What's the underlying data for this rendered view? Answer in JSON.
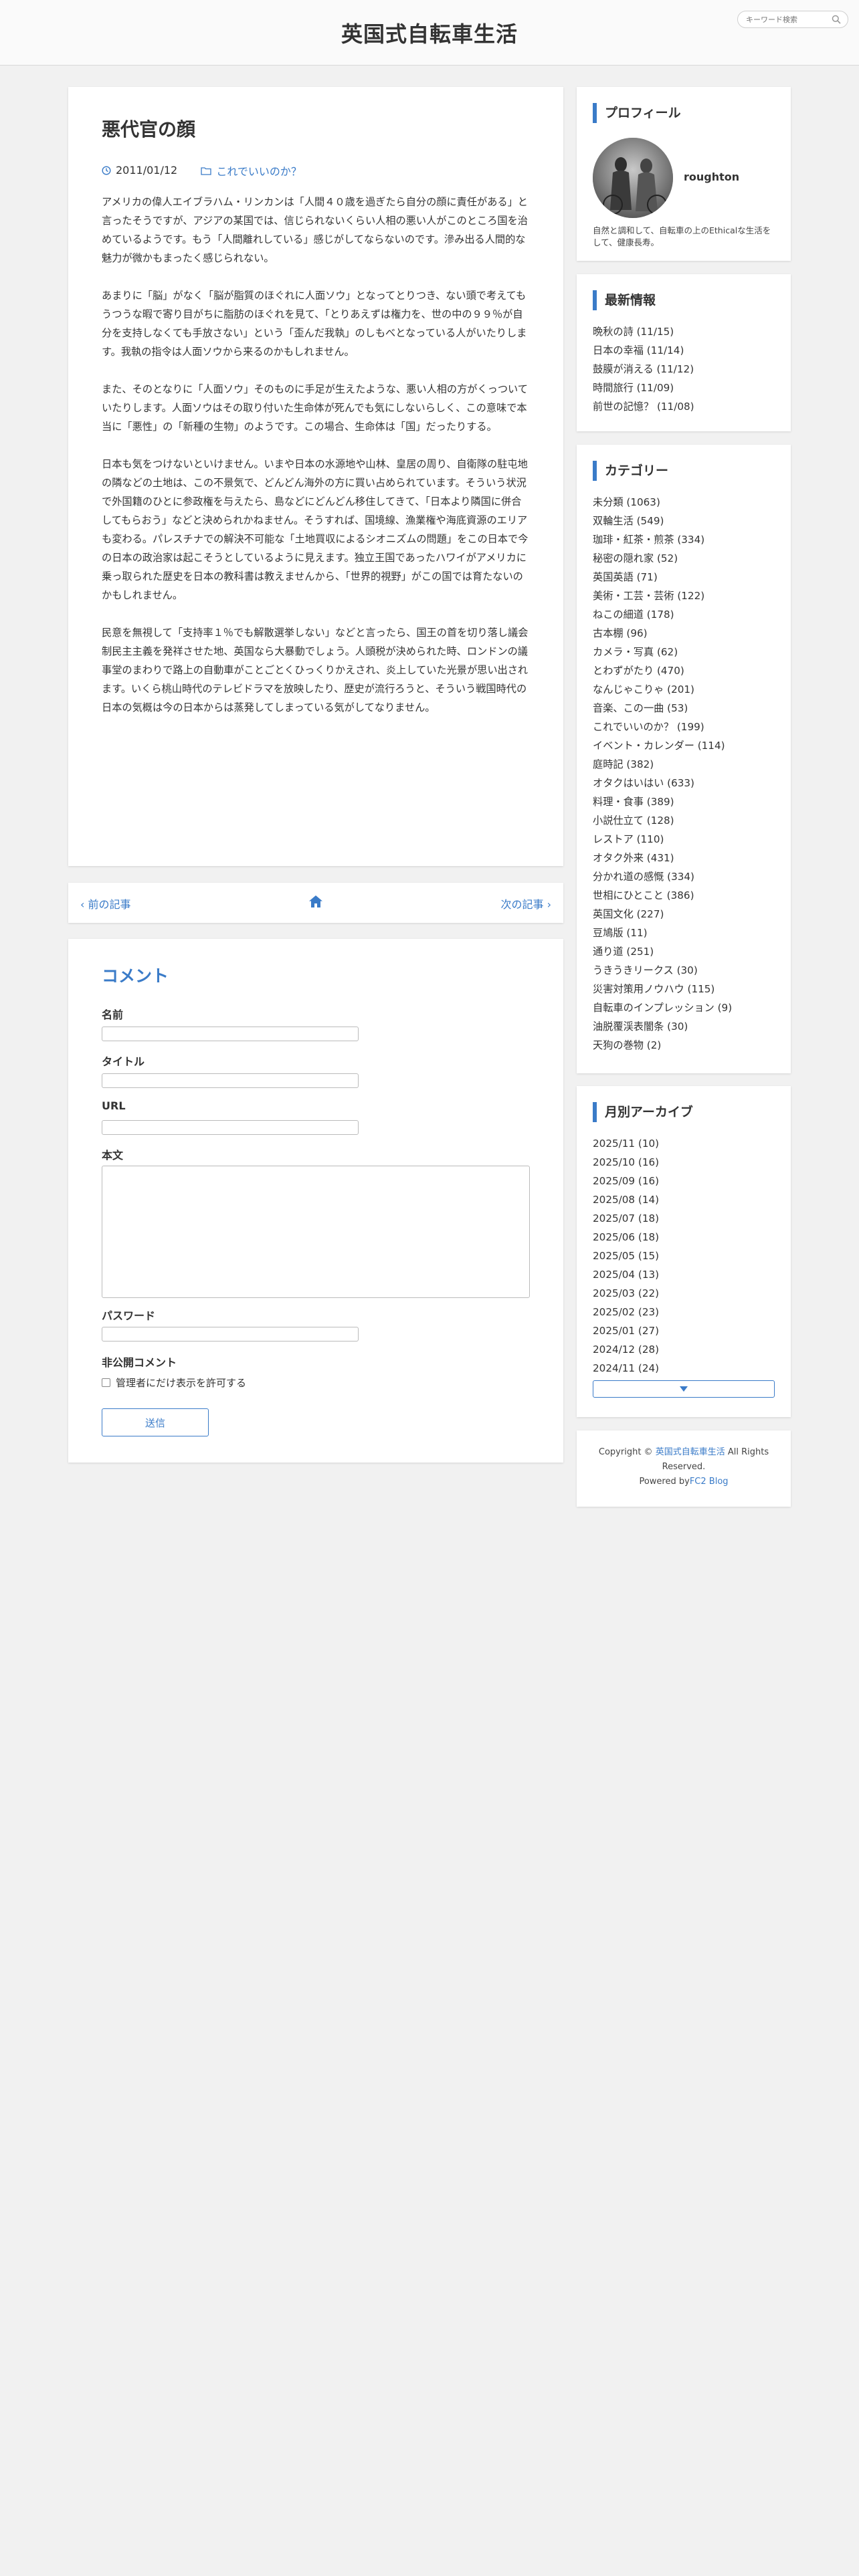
{
  "header": {
    "site_title": "英国式自転車生活",
    "search_placeholder": "キーワード検索"
  },
  "article": {
    "title": "悪代官の顔",
    "date": "2011/01/12",
    "category": "これでいいのか？",
    "paragraphs": [
      "アメリカの偉人エイブラハム・リンカンは「人間４０歳を過ぎたら自分の顔に責任がある」と言ったそうですが、アジアの某国では、信じられないくらい人相の悪い人がこのところ国を治めているようです。もう「人間離れしている」感じがしてならないのです。滲み出る人間的な魅力が微かもまったく感じられない。",
      "あまりに「脳」がなく「脳が脂質のほぐれに人面ソウ」となってとりつき、ない頭で考えてもうつうな暇で寄り目がちに脂肪のほぐれを見て、「とりあえずは権力を、世の中の９９％が自分を支持しなくても手放さない」という「歪んだ我執」のしもべとなっている人がいたりします。我執の指令は人面ソウから来るのかもしれません。",
      "また、そのとなりに「人面ソウ」そのものに手足が生えたような、悪い人相の方がくっついていたりします。人面ソウはその取り付いた生命体が死んでも気にしないらしく、この意味で本当に「悪性」の「新種の生物」のようです。この場合、生命体は「国」だったりする。",
      "日本も気をつけないといけません。いまや日本の水源地や山林、皇居の周り、自衛隊の駐屯地の隣などの土地は、この不景気で、どんどん海外の方に買い占められています。そういう状況で外国籍のひとに参政権を与えたら、島などにどんどん移住してきて、「日本より隣国に併合してもらおう」などと決められかねません。そうすれば、国境線、漁業権や海底資源のエリアも変わる。パレスチナでの解決不可能な「土地買収によるシオニズムの問題」をこの日本で今の日本の政治家は起こそうとしているように見えます。独立王国であったハワイがアメリカに乗っ取られた歴史を日本の教科書は教えませんから、「世界的視野」がこの国では育たないのかもしれません。",
      "民意を無視して「支持率１％でも解散選挙しない」などと言ったら、国王の首を切り落し議会制民主主義を発祥させた地、英国なら大暴動でしょう。人頭税が決められた時、ロンドンの議事堂のまわりで路上の自動車がことごとくひっくりかえされ、炎上していた光景が思い出されます。いくら桃山時代のテレビドラマを放映したり、歴史が流行ろうと、そういう戦国時代の日本の気概は今の日本からは蒸発してしまっている気がしてなりません。"
    ]
  },
  "post_nav": {
    "prev": "前の記事",
    "next": "次の記事"
  },
  "comment_form": {
    "heading": "コメント",
    "name_label": "名前",
    "title_label": "タイトル",
    "url_label": "URL",
    "body_label": "本文",
    "password_label": "パスワード",
    "private_label": "非公開コメント",
    "private_checkbox": "管理者にだけ表示を許可する",
    "submit": "送信"
  },
  "sidebar": {
    "profile": {
      "title": "プロフィール",
      "name": "roughton",
      "description": "自然と調和して、自転車の上のEthicalな生活をして、健康長寿。"
    },
    "latest": {
      "title": "最新情報",
      "items": [
        "晩秋の詩 (11/15)",
        "日本の幸福 (11/14)",
        "鼓膜が消える (11/12)",
        "時間旅行 (11/09)",
        "前世の記憶？ (11/08)"
      ]
    },
    "categories": {
      "title": "カテゴリー",
      "items": [
        "未分類 (1063)",
        "双輪生活 (549)",
        "珈琲・紅茶・煎茶 (334)",
        "秘密の隠れ家 (52)",
        "英国英語 (71)",
        "美術・工芸・芸術 (122)",
        "ねこの細道 (178)",
        "古本棚 (96)",
        "カメラ・写真 (62)",
        "とわずがたり (470)",
        "なんじゃこりゃ (201)",
        "音楽、この一曲 (53)",
        "これでいいのか？ (199)",
        "イベント・カレンダー (114)",
        "庭時記 (382)",
        "オタクはいはい (633)",
        "料理・食事 (389)",
        "小説仕立て (128)",
        "レストア (110)",
        "オタク外来 (431)",
        "分かれ道の感慨 (334)",
        "世相にひとこと (386)",
        "英国文化 (227)",
        "豆鳩版 (11)",
        "通り道 (251)",
        "うきうきリークス (30)",
        "災害対策用ノウハウ (115)",
        "自転車のインプレッション (9)",
        "油脱覆渓表闇条 (30)",
        "天狗の巻物 (2)"
      ]
    },
    "archive": {
      "title": "月別アーカイブ",
      "items": [
        "2025/11 (10)",
        "2025/10 (16)",
        "2025/09 (16)",
        "2025/08 (14)",
        "2025/07 (18)",
        "2025/06 (18)",
        "2025/05 (15)",
        "2025/04 (13)",
        "2025/03 (22)",
        "2025/02 (23)",
        "2025/01 (27)",
        "2024/12 (28)",
        "2024/11 (24)"
      ]
    },
    "footer": {
      "prefix": "Copyright © ",
      "site_link": "英国式自転車生活",
      "rights": " All Rights Reserved.",
      "powered_prefix": "Powered by",
      "powered_link": "FC2 Blog"
    }
  },
  "colors": {
    "accent": "#3a7bc8",
    "background": "#f1f1f1",
    "card": "#ffffff",
    "text": "#333333"
  }
}
